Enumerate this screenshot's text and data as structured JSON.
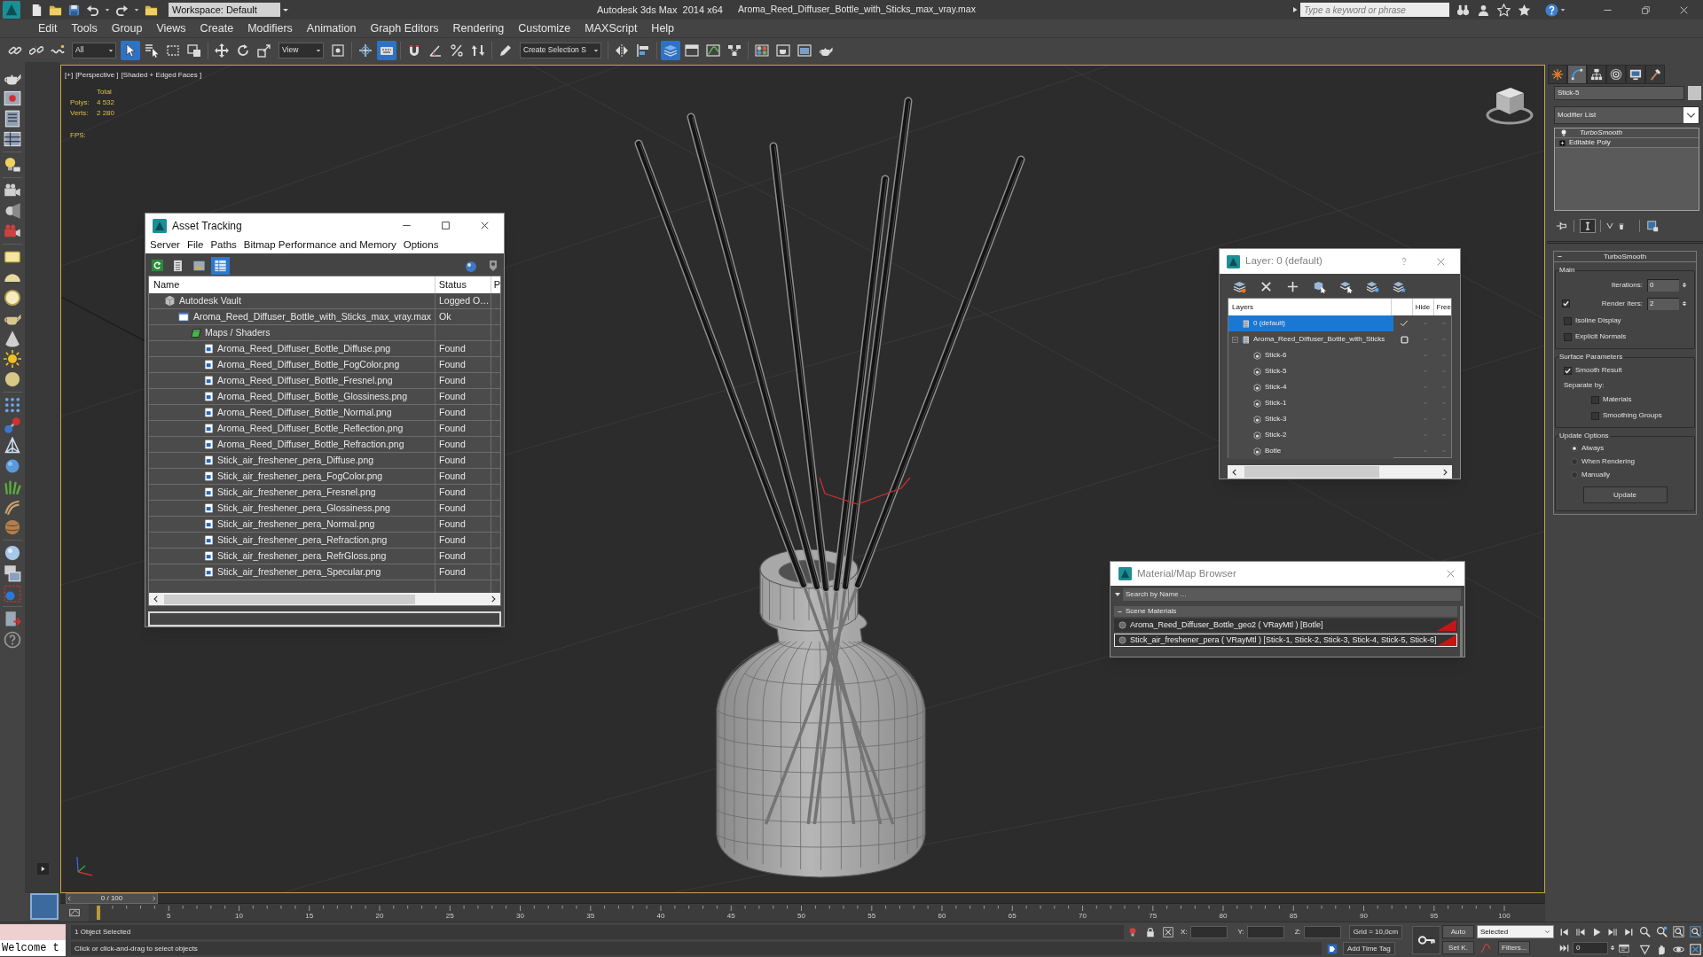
{
  "title_bar": {
    "workspace": "Workspace: Default",
    "app_title": "Autodesk 3ds Max  2014 x64",
    "file_name": "Aroma_Reed_Diffuser_Bottle_with_Sticks_max_vray.max",
    "search": {
      "placeholder": "Type a keyword or phrase"
    }
  },
  "menu_bar": [
    "Edit",
    "Tools",
    "Group",
    "Views",
    "Create",
    "Modifiers",
    "Animation",
    "Graph Editors",
    "Rendering",
    "Customize",
    "MAXScript",
    "Help"
  ],
  "main_toolbar": {
    "selection_filter": "All",
    "reference_coordinate_system": "View",
    "named_selection_set": "Create Selection S",
    "tools": [
      {
        "active": false
      },
      {
        "active": false
      },
      {
        "active": false
      },
      {
        "active": true
      },
      {
        "active": false
      },
      {
        "active": false
      },
      {
        "active": false
      },
      {
        "active": false
      },
      {
        "active": false
      },
      {
        "active": false
      },
      {
        "active": false
      },
      {
        "active": false
      },
      {
        "active": true
      },
      {
        "active": false
      },
      {
        "active": false
      },
      {
        "active": false
      },
      {
        "active": false
      },
      {
        "active": false
      },
      {
        "active": false
      },
      {
        "active": false
      },
      {
        "active": true
      },
      {
        "active": false
      },
      {
        "active": false
      },
      {
        "active": false
      },
      {
        "active": false
      },
      {
        "active": false
      },
      {
        "active": false
      },
      {
        "active": false
      }
    ]
  },
  "viewport": {
    "labels": [
      "[+]",
      "[Perspective ]",
      "[Shaded + Edged Faces ]"
    ],
    "stats": {
      "header": "Total",
      "rows": [
        {
          "label": "Polys:",
          "value": "4 532"
        },
        {
          "label": "Verts:",
          "value": "2 280"
        }
      ],
      "fps_label": "FPS:"
    }
  },
  "asset_tracking": {
    "title": "Asset Tracking",
    "menu": [
      "Server",
      "File",
      "Paths",
      "Bitmap Performance and Memory",
      "Options"
    ],
    "view_modes": [
      {
        "selected": false
      },
      {
        "selected": false
      },
      {
        "selected": true
      }
    ],
    "columns": [
      "Name",
      "Status",
      "P"
    ],
    "rows": [
      {
        "kind": "vault",
        "name": "Autodesk Vault",
        "status": "Logged O…",
        "children": [
          {
            "kind": "scene",
            "name": "Aroma_Reed_Diffuser_Bottle_with_Sticks_max_vray.max",
            "status": "Ok",
            "children": [
              {
                "kind": "folder",
                "name": "Maps / Shaders",
                "children": [
                  {
                    "kind": "bitmap",
                    "name": "Aroma_Reed_Diffuser_Bottle_Diffuse.png",
                    "status": "Found"
                  },
                  {
                    "kind": "bitmap",
                    "name": "Aroma_Reed_Diffuser_Bottle_FogColor.png",
                    "status": "Found"
                  },
                  {
                    "kind": "bitmap",
                    "name": "Aroma_Reed_Diffuser_Bottle_Fresnel.png",
                    "status": "Found"
                  },
                  {
                    "kind": "bitmap",
                    "name": "Aroma_Reed_Diffuser_Bottle_Glossiness.png",
                    "status": "Found"
                  },
                  {
                    "kind": "bitmap",
                    "name": "Aroma_Reed_Diffuser_Bottle_Normal.png",
                    "status": "Found"
                  },
                  {
                    "kind": "bitmap",
                    "name": "Aroma_Reed_Diffuser_Bottle_Reflection.png",
                    "status": "Found"
                  },
                  {
                    "kind": "bitmap",
                    "name": "Aroma_Reed_Diffuser_Bottle_Refraction.png",
                    "status": "Found"
                  },
                  {
                    "kind": "bitmap",
                    "name": "Stick_air_freshener_pera_Diffuse.png",
                    "status": "Found"
                  },
                  {
                    "kind": "bitmap",
                    "name": "Stick_air_freshener_pera_FogColor.png",
                    "status": "Found"
                  },
                  {
                    "kind": "bitmap",
                    "name": "Stick_air_freshener_pera_Fresnel.png",
                    "status": "Found"
                  },
                  {
                    "kind": "bitmap",
                    "name": "Stick_air_freshener_pera_Glossiness.png",
                    "status": "Found"
                  },
                  {
                    "kind": "bitmap",
                    "name": "Stick_air_freshener_pera_Normal.png",
                    "status": "Found"
                  },
                  {
                    "kind": "bitmap",
                    "name": "Stick_air_freshener_pera_Refraction.png",
                    "status": "Found"
                  },
                  {
                    "kind": "bitmap",
                    "name": "Stick_air_freshener_pera_RefrGloss.png",
                    "status": "Found"
                  },
                  {
                    "kind": "bitmap",
                    "name": "Stick_air_freshener_pera_Specular.png",
                    "status": "Found"
                  }
                ]
              }
            ]
          }
        ]
      }
    ]
  },
  "layer_manager": {
    "title": "Layer: 0 (default)",
    "columns": [
      "Layers",
      "Hide",
      "Free"
    ],
    "layers": [
      {
        "name": "0 (default)",
        "selected": true,
        "current": true,
        "hidden": false,
        "frozen": false
      },
      {
        "name": "Aroma_Reed_Diffuser_Bottle_with_Sticks",
        "selected": false,
        "current": false,
        "expanded": true,
        "hidden": false,
        "frozen": false,
        "children": [
          {
            "name": "Stick-6",
            "selected": false,
            "hidden": false,
            "frozen": false
          },
          {
            "name": "Stick-5",
            "selected": false,
            "hidden": false,
            "frozen": false
          },
          {
            "name": "Stick-4",
            "selected": false,
            "hidden": false,
            "frozen": false
          },
          {
            "name": "Stick-1",
            "selected": false,
            "hidden": false,
            "frozen": false
          },
          {
            "name": "Stick-3",
            "selected": false,
            "hidden": false,
            "frozen": false
          },
          {
            "name": "Stick-2",
            "selected": false,
            "hidden": false,
            "frozen": false
          },
          {
            "name": "Botle",
            "selected": false,
            "hidden": false,
            "frozen": false
          }
        ]
      }
    ]
  },
  "material_browser": {
    "title": "Material/Map Browser",
    "search": {
      "placeholder": "Search by Name ..."
    },
    "group": {
      "title": "Scene Materials",
      "expanded": true
    },
    "materials": [
      {
        "label": "Aroma_Reed_Diffuser_Bottle_geo2 ( VRayMtl ) [Botle]",
        "selected": false
      },
      {
        "label": "Stick_air_freshener_pera ( VRayMtl ) [Stick-1, Stick-2, Stick-3, Stick-4, Stick-5, Stick-6]",
        "selected": true
      }
    ]
  },
  "command_panel": {
    "tabs": [
      {
        "selected": false
      },
      {
        "selected": true
      },
      {
        "selected": false
      },
      {
        "selected": false
      },
      {
        "selected": false
      },
      {
        "selected": false
      }
    ],
    "object_name": "Stick-5",
    "modifier_list": "Modifier List",
    "modifier_stack": [
      {
        "kind": "modifier",
        "label": "TurboSmooth"
      },
      {
        "kind": "base_object",
        "label": "Editable Poly"
      }
    ],
    "show_end_result": true,
    "rollout": {
      "title": "TurboSmooth",
      "expanded": true,
      "groups": [
        {
          "title": "Main",
          "controls": [
            {
              "kind": "spinner",
              "label": "Iterations:",
              "value": "0"
            },
            {
              "kind": "checked_spinner",
              "label": "Render Iters:",
              "value": "2",
              "checked": true
            },
            {
              "kind": "checkbox",
              "label": "Isoline Display",
              "checked": false
            },
            {
              "kind": "checkbox",
              "label": "Explicit Normals",
              "checked": false
            }
          ]
        },
        {
          "title": "Surface Parameters",
          "controls": [
            {
              "kind": "checkbox",
              "label": "Smooth Result",
              "checked": true
            },
            {
              "kind": "label",
              "label": "Separate by:",
              "children": [
                {
                  "kind": "checkbox",
                  "label": "Materials",
                  "checked": false
                },
                {
                  "kind": "checkbox",
                  "label": "Smoothing Groups",
                  "checked": false
                }
              ]
            }
          ]
        },
        {
          "title": "Update Options",
          "controls": [
            {
              "kind": "radio",
              "label": "Always",
              "selected": true
            },
            {
              "kind": "radio",
              "label": "When Rendering",
              "selected": false
            },
            {
              "kind": "radio",
              "label": "Manually",
              "selected": false
            },
            {
              "kind": "button",
              "label": "Update"
            }
          ]
        }
      ]
    }
  },
  "timeline": {
    "position": "0 / 100",
    "level": 0,
    "frame_labels": [
      "5",
      "10",
      "15",
      "20",
      "25",
      "30",
      "35",
      "40",
      "45",
      "50",
      "55",
      "60",
      "65",
      "70",
      "75",
      "80",
      "85",
      "90",
      "95",
      "100"
    ]
  },
  "status_bar": {
    "listener_output": "Welcome t",
    "selection_info": "1 Object Selected",
    "prompt": "Click or click-and-drag to select objects",
    "coordinate_labels": [
      "X:",
      "Y:",
      "Z:"
    ],
    "grid": "Grid = 10,0cm",
    "time_tag": "Add Time Tag",
    "auto_key": "Auto",
    "set_key": "Set K.",
    "key_filter": "Selected",
    "filters": "Filters...",
    "current_frame": "0"
  }
}
